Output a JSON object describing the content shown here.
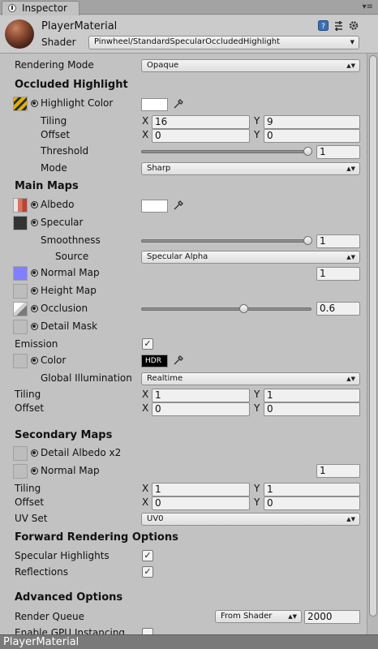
{
  "tab": {
    "title": "Inspector"
  },
  "header": {
    "material_name": "PlayerMaterial",
    "shader_label": "Shader",
    "shader_value": "Pinwheel/StandardSpecularOccludedHighlight"
  },
  "rendering_mode": {
    "label": "Rendering Mode",
    "value": "Opaque"
  },
  "occluded_highlight": {
    "title": "Occluded Highlight",
    "highlight_color_label": "Highlight Color",
    "tiling_label": "Tiling",
    "tiling_x": "16",
    "tiling_y": "9",
    "offset_label": "Offset",
    "offset_x": "0",
    "offset_y": "0",
    "threshold_label": "Threshold",
    "threshold_value": "1",
    "mode_label": "Mode",
    "mode_value": "Sharp"
  },
  "main_maps": {
    "title": "Main Maps",
    "albedo_label": "Albedo",
    "specular_label": "Specular",
    "smoothness_label": "Smoothness",
    "smoothness_value": "1",
    "source_label": "Source",
    "source_value": "Specular Alpha",
    "normal_label": "Normal Map",
    "normal_value": "1",
    "height_label": "Height Map",
    "occlusion_label": "Occlusion",
    "occlusion_value": "0.6",
    "detail_mask_label": "Detail Mask",
    "emission_label": "Emission",
    "color_label": "Color",
    "hdr_label": "HDR",
    "gi_label": "Global Illumination",
    "gi_value": "Realtime",
    "tiling_label": "Tiling",
    "tiling_x": "1",
    "tiling_y": "1",
    "offset_label": "Offset",
    "offset_x": "0",
    "offset_y": "0"
  },
  "secondary_maps": {
    "title": "Secondary Maps",
    "detail_albedo_label": "Detail Albedo x2",
    "normal_label": "Normal Map",
    "normal_value": "1",
    "tiling_label": "Tiling",
    "tiling_x": "1",
    "tiling_y": "1",
    "offset_label": "Offset",
    "offset_x": "0",
    "offset_y": "0",
    "uv_label": "UV Set",
    "uv_value": "UV0"
  },
  "forward": {
    "title": "Forward Rendering Options",
    "specular_label": "Specular Highlights",
    "reflections_label": "Reflections"
  },
  "advanced": {
    "title": "Advanced Options",
    "queue_label": "Render Queue",
    "queue_source": "From Shader",
    "queue_value": "2000",
    "gpu_label": "Enable GPU Instancing"
  },
  "xy": {
    "x": "X",
    "y": "Y"
  },
  "footer": {
    "title": "PlayerMaterial"
  },
  "colors": {
    "background": "#c2c2c2",
    "normal_map": "#8080ff",
    "specular": "#333333"
  }
}
